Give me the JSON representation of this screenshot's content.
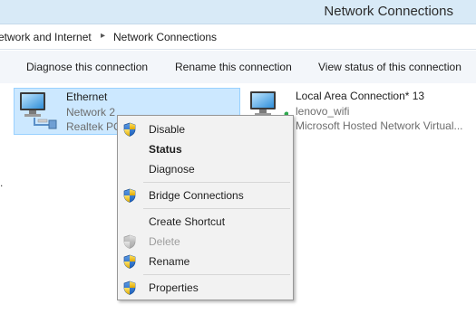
{
  "window": {
    "title": "Network Connections"
  },
  "breadcrumb": {
    "items": [
      {
        "label": "etwork and Internet"
      },
      {
        "label": "Network Connections"
      }
    ]
  },
  "commandbar": {
    "diagnose": "Diagnose this connection",
    "rename": "Rename this connection",
    "view_status": "View status of this connection"
  },
  "connections": [
    {
      "name": "Ethernet",
      "network": "Network  2",
      "adapter": "Realtek PC"
    },
    {
      "name": "Local Area Connection* 13",
      "network": "lenovo_wifi",
      "adapter": "Microsoft Hosted Network Virtual..."
    }
  ],
  "stray_text": ".",
  "context_menu": {
    "items": [
      {
        "label": "Disable",
        "icon": "uac-shield-icon"
      },
      {
        "label": "Status"
      },
      {
        "label": "Diagnose"
      },
      {
        "label": "Bridge Connections",
        "icon": "uac-shield-icon"
      },
      {
        "label": "Create Shortcut"
      },
      {
        "label": "Delete",
        "icon": "uac-shield-icon"
      },
      {
        "label": "Rename",
        "icon": "uac-shield-icon"
      },
      {
        "label": "Properties",
        "icon": "uac-shield-icon"
      }
    ]
  },
  "colors": {
    "titlebar": "#d8eaf7",
    "selection": "#cce8ff",
    "selection_border": "#99d1ff",
    "menu_bg": "#f2f2f2"
  }
}
